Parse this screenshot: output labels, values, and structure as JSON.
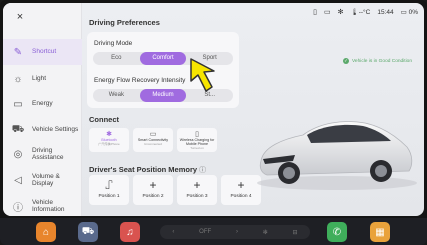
{
  "sidebar": {
    "close_label": "×",
    "items": [
      {
        "label": "Shortcut",
        "icon": "pencil-icon",
        "glyph": "✎"
      },
      {
        "label": "Light",
        "icon": "light-icon",
        "glyph": "☼"
      },
      {
        "label": "Energy",
        "icon": "battery-icon",
        "glyph": "▭"
      },
      {
        "label": "Vehicle Settings",
        "icon": "car-icon",
        "glyph": "⛟"
      },
      {
        "label": "Driving Assistance",
        "icon": "steering-icon",
        "glyph": "◎"
      },
      {
        "label": "Volume & Display",
        "icon": "volume-icon",
        "glyph": "◁"
      },
      {
        "label": "Vehicle Information",
        "icon": "info-icon",
        "glyph": "ⓘ"
      }
    ]
  },
  "driving": {
    "title": "Driving Preferences",
    "mode_label": "Driving Mode",
    "modes": [
      "Eco",
      "Comfort",
      "Sport"
    ],
    "selected_mode": "Comfort",
    "recovery_label": "Energy Flow Recovery Intensity",
    "recovery": [
      "Weak",
      "Medium",
      "St..."
    ],
    "selected_recovery": "Medium"
  },
  "connect": {
    "title": "Connect",
    "tiles": [
      {
        "title": "Bluetooth",
        "sub": "广汽传祺iPhone",
        "glyph": "✱"
      },
      {
        "title": "Smart Connectivity",
        "sub": "Unconnected",
        "glyph": "▭"
      },
      {
        "title": "Wireless Charging for Mobile Phone",
        "sub": "Turned on",
        "glyph": "▯"
      }
    ]
  },
  "seat": {
    "title": "Driver's Seat Position Memory",
    "positions": [
      "Position 1",
      "Position 2",
      "Position 3",
      "Position 4"
    ]
  },
  "status": {
    "temp": "🌡--°C",
    "time": "15:44",
    "battery": "0%"
  },
  "vehicle_badge": "Vehicle is in Good Condition",
  "dock": {
    "climate_label": "OFF"
  },
  "colors": {
    "accent": "#a06be0",
    "ok": "#5aa86a"
  }
}
